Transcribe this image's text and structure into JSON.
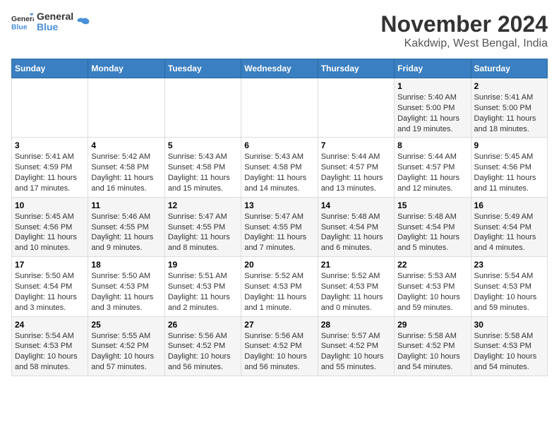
{
  "logo": {
    "text_general": "General",
    "text_blue": "Blue"
  },
  "title": "November 2024",
  "location": "Kakdwip, West Bengal, India",
  "weekdays": [
    "Sunday",
    "Monday",
    "Tuesday",
    "Wednesday",
    "Thursday",
    "Friday",
    "Saturday"
  ],
  "weeks": [
    [
      {
        "day": "",
        "info": ""
      },
      {
        "day": "",
        "info": ""
      },
      {
        "day": "",
        "info": ""
      },
      {
        "day": "",
        "info": ""
      },
      {
        "day": "",
        "info": ""
      },
      {
        "day": "1",
        "info": "Sunrise: 5:40 AM\nSunset: 5:00 PM\nDaylight: 11 hours and 19 minutes."
      },
      {
        "day": "2",
        "info": "Sunrise: 5:41 AM\nSunset: 5:00 PM\nDaylight: 11 hours and 18 minutes."
      }
    ],
    [
      {
        "day": "3",
        "info": "Sunrise: 5:41 AM\nSunset: 4:59 PM\nDaylight: 11 hours and 17 minutes."
      },
      {
        "day": "4",
        "info": "Sunrise: 5:42 AM\nSunset: 4:58 PM\nDaylight: 11 hours and 16 minutes."
      },
      {
        "day": "5",
        "info": "Sunrise: 5:43 AM\nSunset: 4:58 PM\nDaylight: 11 hours and 15 minutes."
      },
      {
        "day": "6",
        "info": "Sunrise: 5:43 AM\nSunset: 4:58 PM\nDaylight: 11 hours and 14 minutes."
      },
      {
        "day": "7",
        "info": "Sunrise: 5:44 AM\nSunset: 4:57 PM\nDaylight: 11 hours and 13 minutes."
      },
      {
        "day": "8",
        "info": "Sunrise: 5:44 AM\nSunset: 4:57 PM\nDaylight: 11 hours and 12 minutes."
      },
      {
        "day": "9",
        "info": "Sunrise: 5:45 AM\nSunset: 4:56 PM\nDaylight: 11 hours and 11 minutes."
      }
    ],
    [
      {
        "day": "10",
        "info": "Sunrise: 5:45 AM\nSunset: 4:56 PM\nDaylight: 11 hours and 10 minutes."
      },
      {
        "day": "11",
        "info": "Sunrise: 5:46 AM\nSunset: 4:55 PM\nDaylight: 11 hours and 9 minutes."
      },
      {
        "day": "12",
        "info": "Sunrise: 5:47 AM\nSunset: 4:55 PM\nDaylight: 11 hours and 8 minutes."
      },
      {
        "day": "13",
        "info": "Sunrise: 5:47 AM\nSunset: 4:55 PM\nDaylight: 11 hours and 7 minutes."
      },
      {
        "day": "14",
        "info": "Sunrise: 5:48 AM\nSunset: 4:54 PM\nDaylight: 11 hours and 6 minutes."
      },
      {
        "day": "15",
        "info": "Sunrise: 5:48 AM\nSunset: 4:54 PM\nDaylight: 11 hours and 5 minutes."
      },
      {
        "day": "16",
        "info": "Sunrise: 5:49 AM\nSunset: 4:54 PM\nDaylight: 11 hours and 4 minutes."
      }
    ],
    [
      {
        "day": "17",
        "info": "Sunrise: 5:50 AM\nSunset: 4:54 PM\nDaylight: 11 hours and 3 minutes."
      },
      {
        "day": "18",
        "info": "Sunrise: 5:50 AM\nSunset: 4:53 PM\nDaylight: 11 hours and 3 minutes."
      },
      {
        "day": "19",
        "info": "Sunrise: 5:51 AM\nSunset: 4:53 PM\nDaylight: 11 hours and 2 minutes."
      },
      {
        "day": "20",
        "info": "Sunrise: 5:52 AM\nSunset: 4:53 PM\nDaylight: 11 hours and 1 minute."
      },
      {
        "day": "21",
        "info": "Sunrise: 5:52 AM\nSunset: 4:53 PM\nDaylight: 11 hours and 0 minutes."
      },
      {
        "day": "22",
        "info": "Sunrise: 5:53 AM\nSunset: 4:53 PM\nDaylight: 10 hours and 59 minutes."
      },
      {
        "day": "23",
        "info": "Sunrise: 5:54 AM\nSunset: 4:53 PM\nDaylight: 10 hours and 59 minutes."
      }
    ],
    [
      {
        "day": "24",
        "info": "Sunrise: 5:54 AM\nSunset: 4:53 PM\nDaylight: 10 hours and 58 minutes."
      },
      {
        "day": "25",
        "info": "Sunrise: 5:55 AM\nSunset: 4:52 PM\nDaylight: 10 hours and 57 minutes."
      },
      {
        "day": "26",
        "info": "Sunrise: 5:56 AM\nSunset: 4:52 PM\nDaylight: 10 hours and 56 minutes."
      },
      {
        "day": "27",
        "info": "Sunrise: 5:56 AM\nSunset: 4:52 PM\nDaylight: 10 hours and 56 minutes."
      },
      {
        "day": "28",
        "info": "Sunrise: 5:57 AM\nSunset: 4:52 PM\nDaylight: 10 hours and 55 minutes."
      },
      {
        "day": "29",
        "info": "Sunrise: 5:58 AM\nSunset: 4:52 PM\nDaylight: 10 hours and 54 minutes."
      },
      {
        "day": "30",
        "info": "Sunrise: 5:58 AM\nSunset: 4:53 PM\nDaylight: 10 hours and 54 minutes."
      }
    ]
  ]
}
